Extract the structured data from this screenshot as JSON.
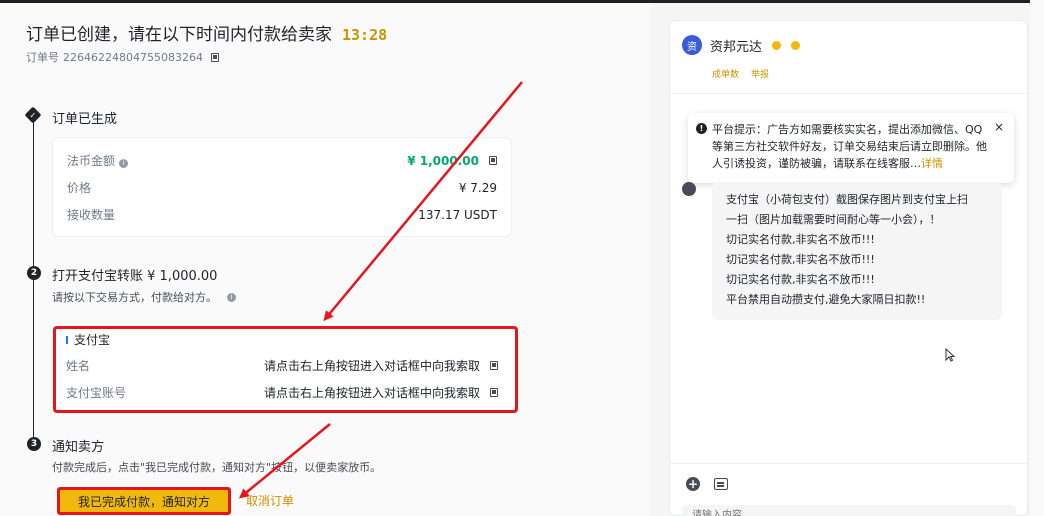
{
  "header": {
    "title": "订单已创建，请在以下时间内付款给卖家",
    "timer": "13:28",
    "order_label": "订单号",
    "order_number": "22646224804755083264"
  },
  "step1": {
    "number": "1",
    "title": "订单已生成",
    "rows": [
      {
        "label": "法币金额",
        "value": "¥ 1,000.00"
      },
      {
        "label": "价格",
        "value": "¥ 7.29"
      },
      {
        "label": "接收数量",
        "value": "137.17 USDT"
      }
    ]
  },
  "step2": {
    "number": "2",
    "title": "打开支付宝转账 ¥ 1,000.00",
    "subtitle": "请按以下交易方式，付款给对方。",
    "method_name": "支付宝",
    "rows": [
      {
        "label": "姓名",
        "value": "请点击右上角按钮进入对话框中向我索取"
      },
      {
        "label": "支付宝账号",
        "value": "请点击右上角按钮进入对话框中向我索取"
      }
    ]
  },
  "step3": {
    "number": "3",
    "title": "通知卖方",
    "subtitle": "付款完成后，点击\"我已完成付款，通知对方\"按钮，以便卖家放币。"
  },
  "actions": {
    "confirm_label": "我已完成付款，通知对方",
    "cancel_label": "取消订单"
  },
  "chat": {
    "avatar_text": "资",
    "merchant_name": "资邦元达",
    "link_orders": "成单数",
    "link_report": "举报",
    "notice_text": "平台提示：广告方如需要核实实名，提出添加微信、QQ等第三方社交软件好友，订单交易结束后请立即删除。他人引诱投资，谨防被骗，请联系在线客服…",
    "notice_more": "详情",
    "notice_close": "×",
    "message_lines": [
      "支付宝（小荷包支付）截图保存图片到支付宝上扫",
      "一扫（图片加载需要时间耐心等一小会），！",
      "切记实名付款,非实名不放币!!!",
      "切记实名付款,非实名不放币!!!",
      "切记实名付款,非实名不放币!!!",
      "平台禁用自动攒支付,避免大家隔日扣款!!"
    ],
    "input_placeholder": "请输入内容..."
  },
  "colors": {
    "accent": "#f0b90b",
    "highlight_red": "#e8141c",
    "amount_green": "#03a66d",
    "link_gold": "#c99400"
  }
}
